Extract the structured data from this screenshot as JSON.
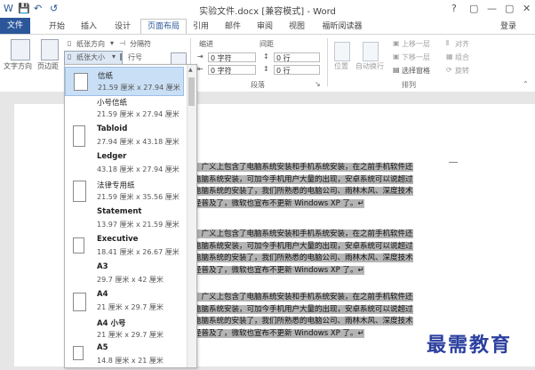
{
  "window": {
    "title": "实验文件.docx [兼容模式] - Word",
    "controls": [
      "?",
      "▢",
      "—",
      "▢",
      "✕"
    ]
  },
  "quick_access": {
    "save": "💾",
    "undo": "↶",
    "redo": "↺"
  },
  "tabs": [
    "文件",
    "开始",
    "插入",
    "设计",
    "页面布局",
    "引用",
    "邮件",
    "审阅",
    "视图",
    "福昕阅读器"
  ],
  "active_tab": "页面布局",
  "user": "登录",
  "ribbon": {
    "page_setup": {
      "text_direction": "文字方向",
      "margins": "页边距",
      "orientation": "纸张方向",
      "size": "纸张大小",
      "breaks": "分隔符",
      "line_numbers": "行号",
      "columns": "分栏"
    },
    "paragraph": {
      "indent_label": "缩进",
      "spacing_label": "间距",
      "indent_left": "0 字符",
      "indent_right": "0 字符",
      "spacing_before": "0 行",
      "spacing_after": "0 行",
      "group_label": "段落"
    },
    "arrange": {
      "position": "位置",
      "wrap_text": "自动换行",
      "bring_forward": "上移一层",
      "send_backward": "下移一层",
      "selection_pane": "选择窗格",
      "align": "对齐",
      "group": "组合",
      "rotate": "旋转",
      "group_label": "排列"
    }
  },
  "paper_sizes": [
    {
      "name": "信纸",
      "size": "21.59 厘米 x 27.94 厘米",
      "selected": true
    },
    {
      "name": "小号信纸",
      "size": "21.59 厘米 x 27.94 厘米",
      "selected": false
    },
    {
      "name": "Tabloid",
      "size": "27.94 厘米 x 43.18 厘米",
      "selected": false
    },
    {
      "name": "Ledger",
      "size": "43.18 厘米 x 27.94 厘米",
      "selected": false
    },
    {
      "name": "法律专用纸",
      "size": "21.59 厘米 x 35.56 厘米",
      "selected": false
    },
    {
      "name": "Statement",
      "size": "13.97 厘米 x 21.59 厘米",
      "selected": false
    },
    {
      "name": "Executive",
      "size": "18.41 厘米 x 26.67 厘米",
      "selected": false
    },
    {
      "name": "A3",
      "size": "29.7 厘米 x 42 厘米",
      "selected": false
    },
    {
      "name": "A4",
      "size": "21 厘米 x 29.7 厘米",
      "selected": false
    },
    {
      "name": "A4 小号",
      "size": "21 厘米 x 29.7 厘米",
      "selected": false
    },
    {
      "name": "A5",
      "size": "14.8 厘米 x 21 厘米",
      "selected": false
    }
  ],
  "document": {
    "paragraphs": [
      [
        "》广义上包含了电脑系统安装和手机系统安装，在之前手机软件还",
        "电脑系统安装，可加今手机用户大量的出现，安卓系统可以说超过",
        "电脑系统的安装了，我们所熟悉的电脑公司、雨林木风、深度技术",
        "经普及了，微软也宣布不更新 Windows XP 了。↵"
      ],
      [
        "》广义上包含了电脑系统安装和手机系统安装，在之前手机软件还",
        "电脑系统安装，可加今手机用户大量的出现，安卓系统可以说超过",
        "电脑系统的安装了，我们所熟悉的电脑公司、雨林木风、深度技术",
        "经普及了，微软也宣布不更新 Windows XP 了。↵"
      ],
      [
        "》广义上包含了电脑系统安装和手机系统安装，在之前手机软件还",
        "电脑系统安装，可加今手机用户大量的出现，安卓系统可以说超过",
        "电脑系统的安装了，我们所熟悉的电脑公司、雨林木风、深度技术",
        "经普及了，微软也宣布不更新 Windows XP 了。↵"
      ]
    ]
  },
  "watermark": "最需教育"
}
